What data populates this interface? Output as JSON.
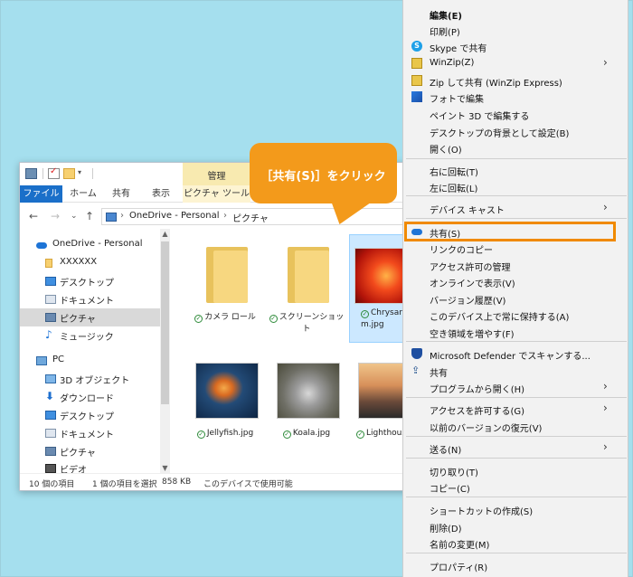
{
  "explorer": {
    "manage_tab": "管理",
    "tabs": {
      "file": "ファイル",
      "home": "ホーム",
      "share": "共有",
      "view": "表示",
      "picture_tools": "ピクチャ ツール"
    },
    "address": {
      "seg1": "OneDrive - Personal",
      "seg2": "ピクチャ"
    },
    "nav": {
      "onedrive": "OneDrive - Personal",
      "xxxxxx": "XXXXXX",
      "desktop1": "デスクトップ",
      "documents1": "ドキュメント",
      "pictures1": "ピクチャ",
      "music": "ミュージック",
      "pc": "PC",
      "objects3d": "3D オブジェクト",
      "downloads": "ダウンロード",
      "desktop2": "デスクトップ",
      "documents2": "ドキュメント",
      "pictures2": "ピクチャ",
      "videos": "ビデオ"
    },
    "files": {
      "camera_roll": "カメラ ロール",
      "screenshots": "スクリーンショット",
      "chrysanthemum_1": "Chrysanthe",
      "chrysanthemum_2": "m.jpg",
      "jellyfish": "Jellyfish.jpg",
      "koala": "Koala.jpg",
      "lighthouse": "Lighthous"
    },
    "status": {
      "count": "10 個の項目",
      "selected": "1 個の項目を選択",
      "size": "858 KB",
      "availability": "このデバイスで使用可能"
    }
  },
  "callout": "［共有(S)］をクリック",
  "menu": {
    "edit": "編集(E)",
    "print": "印刷(P)",
    "skype_share": "Skype で共有",
    "winzip": "WinZip(Z)",
    "zip_share": "Zip して共有 (WinZip Express)",
    "photo_edit": "フォトで編集",
    "paint3d": "ペイント 3D で編集する",
    "set_background": "デスクトップの背景として設定(B)",
    "open": "開く(O)",
    "rotate_right": "右に回転(T)",
    "rotate_left": "左に回転(L)",
    "cast": "デバイス キャスト",
    "share_onedrive": "共有(S)",
    "copy_link": "リンクのコピー",
    "manage_access": "アクセス許可の管理",
    "view_online": "オンラインで表示(V)",
    "version_history": "バージョン履歴(V)",
    "always_keep": "このデバイス上で常に保持する(A)",
    "free_space": "空き領域を増やす(F)",
    "defender": "Microsoft Defender でスキャンする...",
    "share": "共有",
    "open_with": "プログラムから開く(H)",
    "give_access": "アクセスを許可する(G)",
    "restore_versions": "以前のバージョンの復元(V)",
    "send_to": "送る(N)",
    "cut": "切り取り(T)",
    "copy": "コピー(C)",
    "create_shortcut": "ショートカットの作成(S)",
    "delete": "削除(D)",
    "rename": "名前の変更(M)",
    "properties": "プロパティ(R)"
  },
  "colors": {
    "background": "#a5dfee",
    "callout": "#f39a1b",
    "highlight": "#f08a00",
    "file_tab": "#1a6fc9"
  }
}
